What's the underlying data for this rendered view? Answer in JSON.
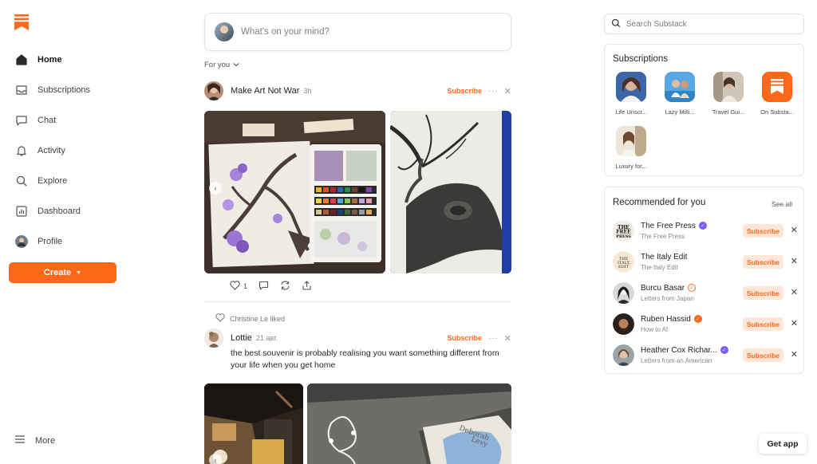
{
  "sidebar": {
    "items": [
      {
        "label": "Home",
        "icon": "home-icon"
      },
      {
        "label": "Subscriptions",
        "icon": "inbox-icon"
      },
      {
        "label": "Chat",
        "icon": "chat-icon"
      },
      {
        "label": "Activity",
        "icon": "bell-icon"
      },
      {
        "label": "Explore",
        "icon": "search-icon"
      },
      {
        "label": "Dashboard",
        "icon": "chart-icon"
      },
      {
        "label": "Profile",
        "icon": "avatar-icon"
      }
    ],
    "create_label": "Create",
    "more_label": "More"
  },
  "composer": {
    "placeholder": "What's on your mind?"
  },
  "feed": {
    "filter_label": "For you",
    "post1": {
      "author": "Make Art Not War",
      "time": "3h",
      "subscribe_label": "Subscribe",
      "like_count": "1"
    },
    "liked_by": "Christine Le liked",
    "post2": {
      "author": "Lottie",
      "time": "21 авг.",
      "subscribe_label": "Subscribe",
      "text": "the best souvenir is probably realising you want something different from your life when you get home"
    }
  },
  "search": {
    "placeholder": "Search Substack"
  },
  "subscriptions": {
    "title": "Subscriptions",
    "items": [
      {
        "caption": "Life Unscr..."
      },
      {
        "caption": "Lazy Milli..."
      },
      {
        "caption": "Travel Gui..."
      },
      {
        "caption": "On Substa..."
      },
      {
        "caption": "Luxury for..."
      }
    ]
  },
  "recommended": {
    "title": "Recommended for you",
    "see_all": "See all",
    "button_label": "Subscribe",
    "items": [
      {
        "name": "The Free Press",
        "subtitle": "The Free Press"
      },
      {
        "name": "The Italy Edit",
        "subtitle": "The Italy Edit"
      },
      {
        "name": "Burcu Basar",
        "subtitle": "Letters from Japan"
      },
      {
        "name": "Ruben Hassid",
        "subtitle": "How to AI"
      },
      {
        "name": "Heather Cox Richar...",
        "subtitle": "Letters from an American"
      }
    ]
  },
  "get_app_label": "Get app",
  "colors": {
    "accent": "#ff6719",
    "accent_soft": "#ffe6d8",
    "verified_purple": "#7a5af8"
  }
}
